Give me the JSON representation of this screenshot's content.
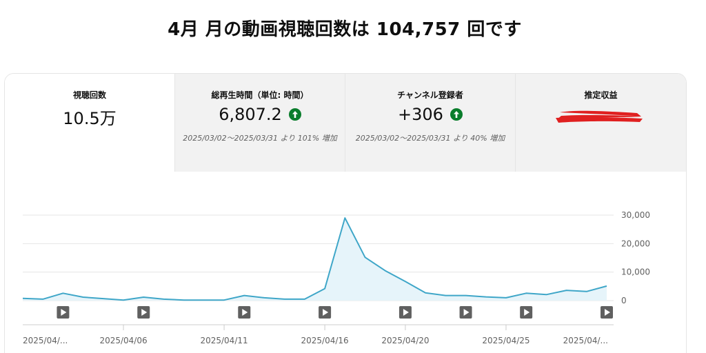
{
  "headline": "4月 月の動画視聴回数は 104,757 回です",
  "tabs": [
    {
      "label": "視聴回数",
      "value": "10.5万"
    },
    {
      "label": "総再生時間（単位: 時間）",
      "value": "6,807.2",
      "sub": "2025/03/02～2025/03/31 より 101% 増加"
    },
    {
      "label": "チャンネル登録者",
      "value": "+306",
      "sub": "2025/03/02～2025/03/31 より 40% 増加"
    },
    {
      "label": "推定収益"
    }
  ],
  "colors": {
    "line": "#3ea6c8",
    "fill": "#e6f4fa",
    "up": "#0a7d2c",
    "redact": "#e02020"
  },
  "chart_data": {
    "type": "area",
    "y_ticks": [
      "30,000",
      "20,000",
      "10,000",
      "0"
    ],
    "ylim": [
      0,
      30000
    ],
    "x_ticks": [
      "2025/04/...",
      "2025/04/06",
      "2025/04/11",
      "2025/04/16",
      "2025/04/20",
      "2025/04/25",
      "2025/04/..."
    ],
    "values": [
      800,
      500,
      2600,
      1200,
      700,
      200,
      1200,
      500,
      200,
      200,
      200,
      1800,
      1000,
      500,
      500,
      4200,
      29000,
      15200,
      10500,
      6700,
      2700,
      1800,
      1800,
      1300,
      1000,
      2600,
      2100,
      3600,
      3200,
      5100
    ]
  }
}
